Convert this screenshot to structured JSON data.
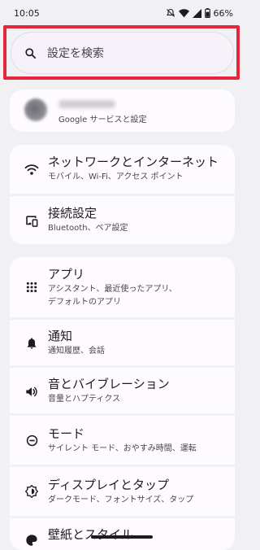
{
  "status_bar": {
    "time": "10:05",
    "battery": "66%",
    "icons": [
      "mute-icon",
      "wifi-icon",
      "signal-icon",
      "battery-icon"
    ]
  },
  "search": {
    "placeholder": "設定を検索",
    "highlight_color": "#e3283d"
  },
  "account": {
    "subtitle": "Google サービスと設定"
  },
  "settings": {
    "network": {
      "title": "ネットワークとインターネット",
      "subtitle": "モバイル、Wi-Fi、アクセス ポイント",
      "icon": "wifi-icon"
    },
    "connected": {
      "title": "接続設定",
      "subtitle": "Bluetooth、ペア設定",
      "icon": "connected-devices-icon"
    },
    "apps": {
      "title": "アプリ",
      "subtitle_lines": [
        "アシスタント、最近使ったアプリ、",
        "デフォルトのアプリ"
      ],
      "icon": "apps-grid-icon"
    },
    "notifications": {
      "title": "通知",
      "subtitle": "通知履歴、会話",
      "icon": "bell-icon"
    },
    "sound": {
      "title": "音とバイブレーション",
      "subtitle": "音量とハプティクス",
      "icon": "volume-icon"
    },
    "modes": {
      "title": "モード",
      "subtitle": "サイレント モード、おやすみ時間、運転",
      "icon": "do-not-disturb-icon"
    },
    "display": {
      "title": "ディスプレイとタップ",
      "subtitle": "ダークモード、フォントサイズ、タップ",
      "icon": "brightness-icon"
    },
    "wallpaper": {
      "title": "壁紙とスタイル",
      "icon": "palette-icon"
    }
  },
  "colors": {
    "background": "#f1f0f2",
    "card": "#fdfbff",
    "text": "#1d1b20"
  }
}
